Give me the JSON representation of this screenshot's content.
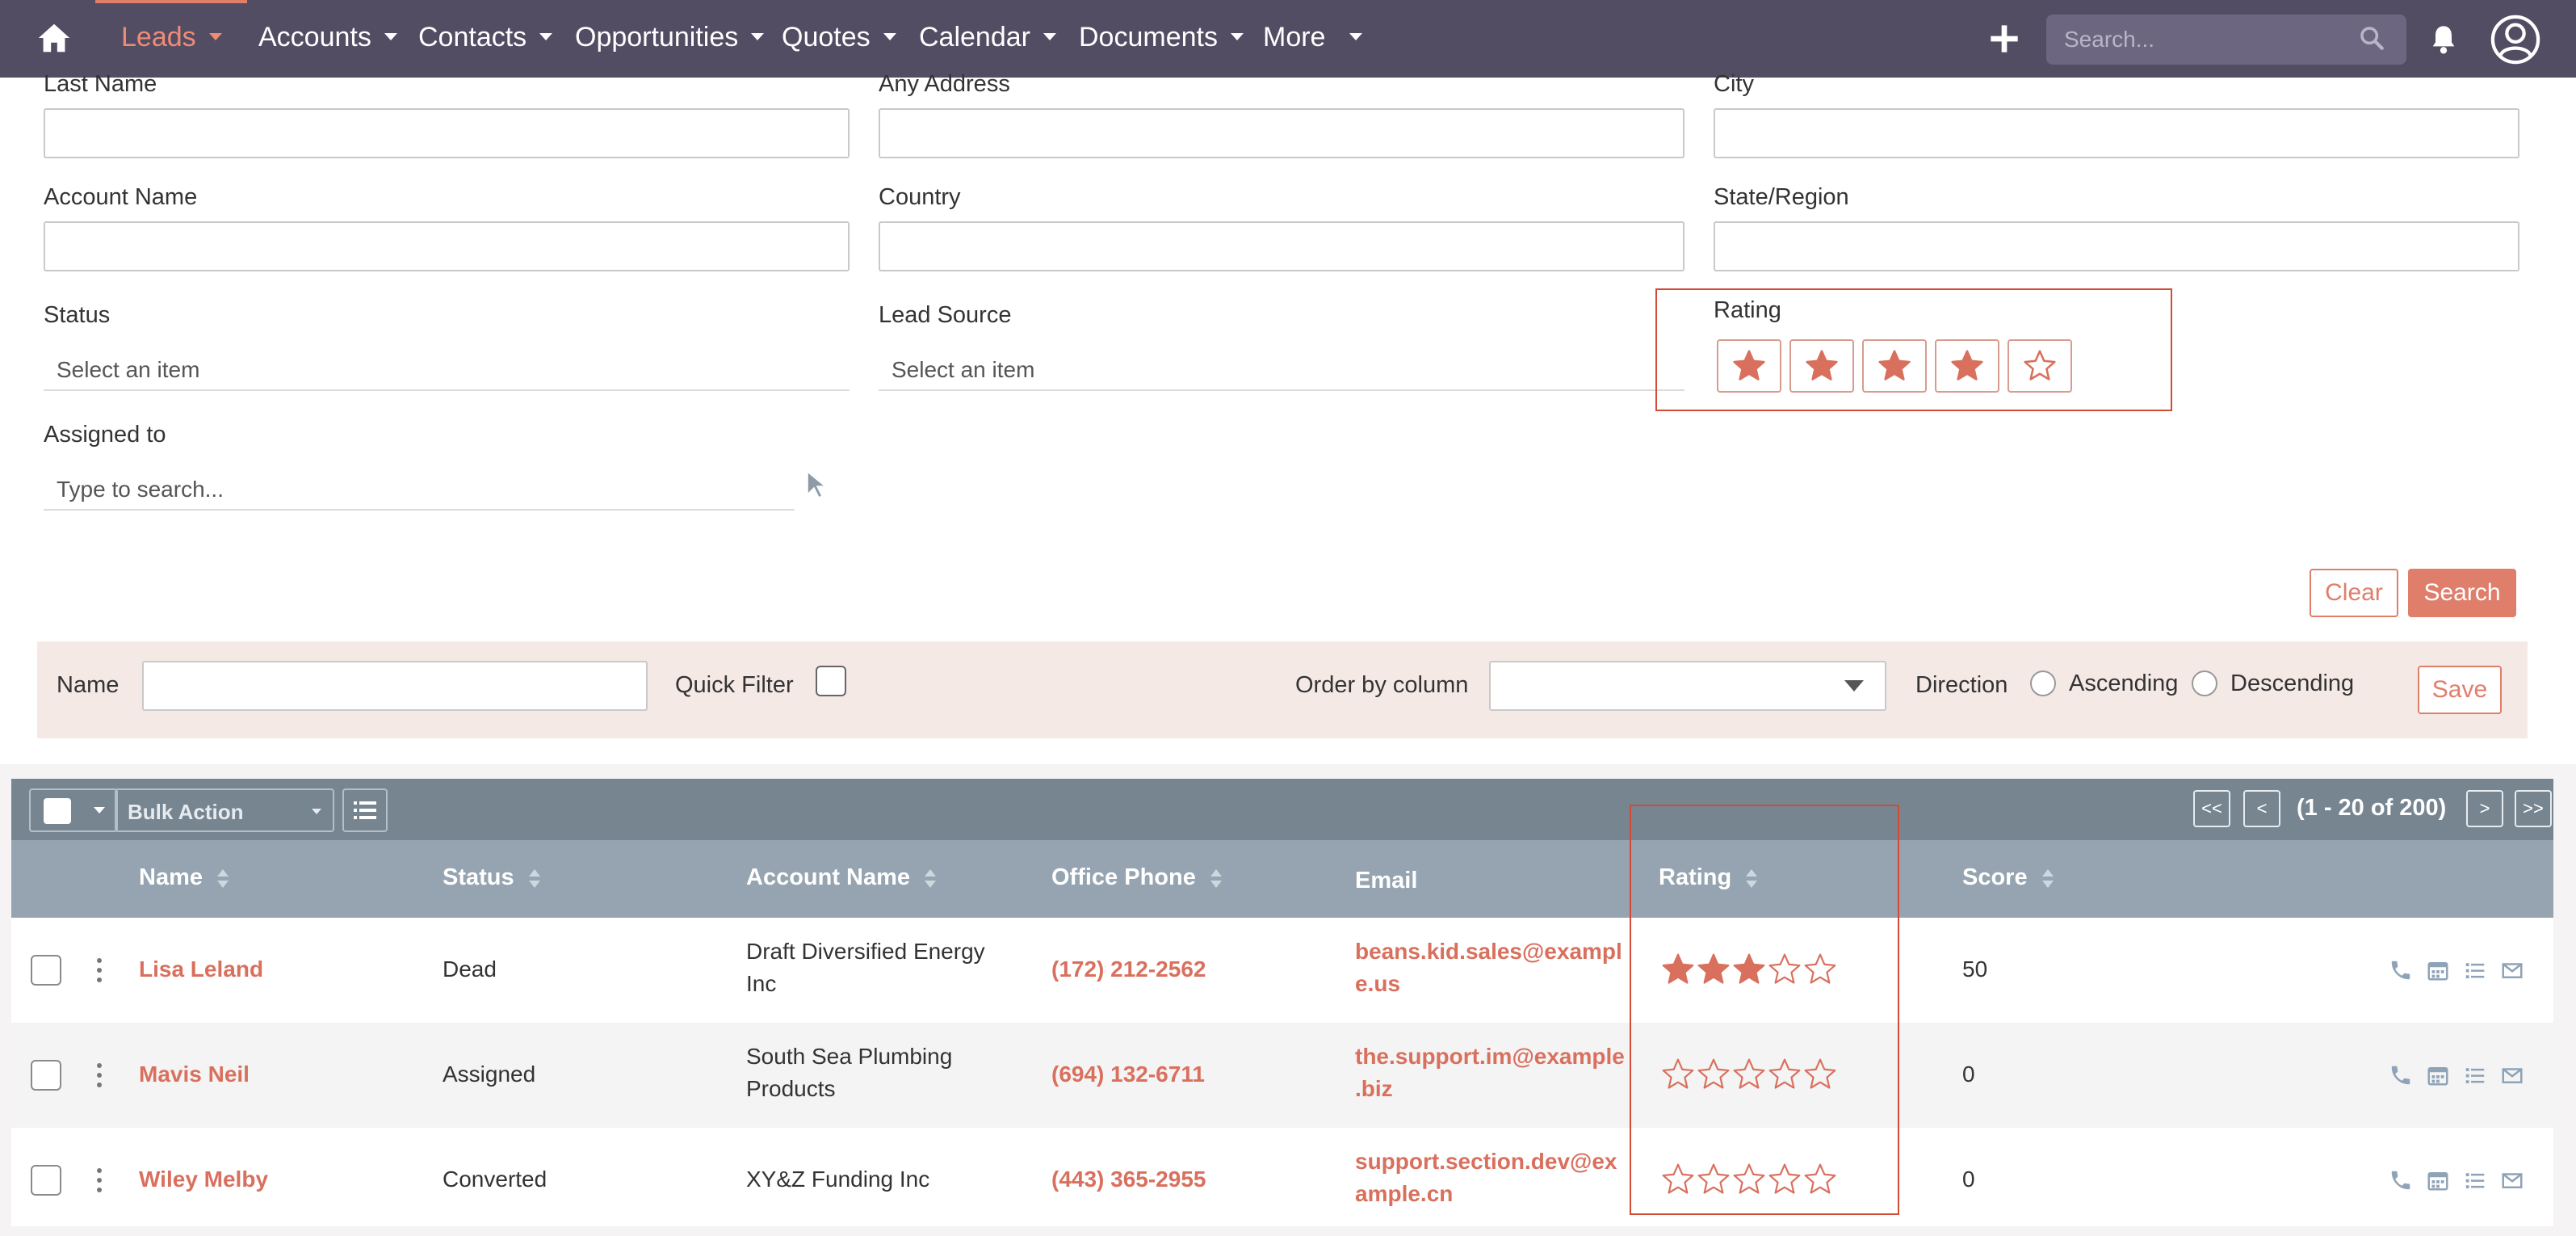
{
  "nav": {
    "items": [
      {
        "label": "Leads",
        "active": true
      },
      {
        "label": "Accounts"
      },
      {
        "label": "Contacts"
      },
      {
        "label": "Opportunities"
      },
      {
        "label": "Quotes"
      },
      {
        "label": "Calendar"
      },
      {
        "label": "Documents"
      },
      {
        "label": "More"
      }
    ],
    "search_placeholder": "Search...",
    "icons": [
      "home-icon",
      "plus-icon",
      "search-icon",
      "bell-icon",
      "user-icon"
    ]
  },
  "filter": {
    "last_name_label": "Last Name",
    "any_address_label": "Any Address",
    "city_label": "City",
    "account_name_label": "Account Name",
    "country_label": "Country",
    "state_label": "State/Region",
    "status_label": "Status",
    "status_placeholder": "Select an item",
    "lead_source_label": "Lead Source",
    "lead_source_placeholder": "Select an item",
    "rating_label": "Rating",
    "rating_value": 4,
    "rating_max": 5,
    "assigned_label": "Assigned to",
    "assigned_placeholder": "Type to search...",
    "clear_label": "Clear",
    "search_label": "Search"
  },
  "saved_filter": {
    "name_label": "Name",
    "quick_filter_label": "Quick Filter",
    "order_label": "Order by column",
    "direction_label": "Direction",
    "ascending_label": "Ascending",
    "descending_label": "Descending",
    "save_label": "Save"
  },
  "list": {
    "bulk_action_label": "Bulk Action",
    "pagination": {
      "first": "<<",
      "prev": "<",
      "info": "(1 - 20 of 200)",
      "next": ">",
      "last": ">>"
    },
    "columns": [
      "Name",
      "Status",
      "Account Name",
      "Office Phone",
      "Email",
      "Rating",
      "Score"
    ],
    "rows": [
      {
        "name": "Lisa Leland",
        "status": "Dead",
        "account_line1": "Draft Diversified Energy",
        "account_line2": "Inc",
        "phone": "(172) 212-2562",
        "email_line1": "beans.kid.sales@exampl",
        "email_line2": "e.us",
        "rating": 3,
        "score": "50"
      },
      {
        "name": "Mavis Neil",
        "status": "Assigned",
        "account_line1": "South Sea Plumbing",
        "account_line2": "Products",
        "phone": "(694) 132-6711",
        "email_line1": "the.support.im@example",
        "email_line2": ".biz",
        "rating": 0,
        "score": "0"
      },
      {
        "name": "Wiley Melby",
        "status": "Converted",
        "account_line1": "XY&Z Funding Inc",
        "account_line2": "",
        "phone": "(443) 365-2955",
        "email_line1": "support.section.dev@ex",
        "email_line2": "ample.cn",
        "rating": 0,
        "score": "0"
      }
    ]
  },
  "colors": {
    "nav_bg": "#534d64",
    "accent": "#e07e6c",
    "highlight": "#d34a36",
    "header_bg": "#95a4b0"
  }
}
